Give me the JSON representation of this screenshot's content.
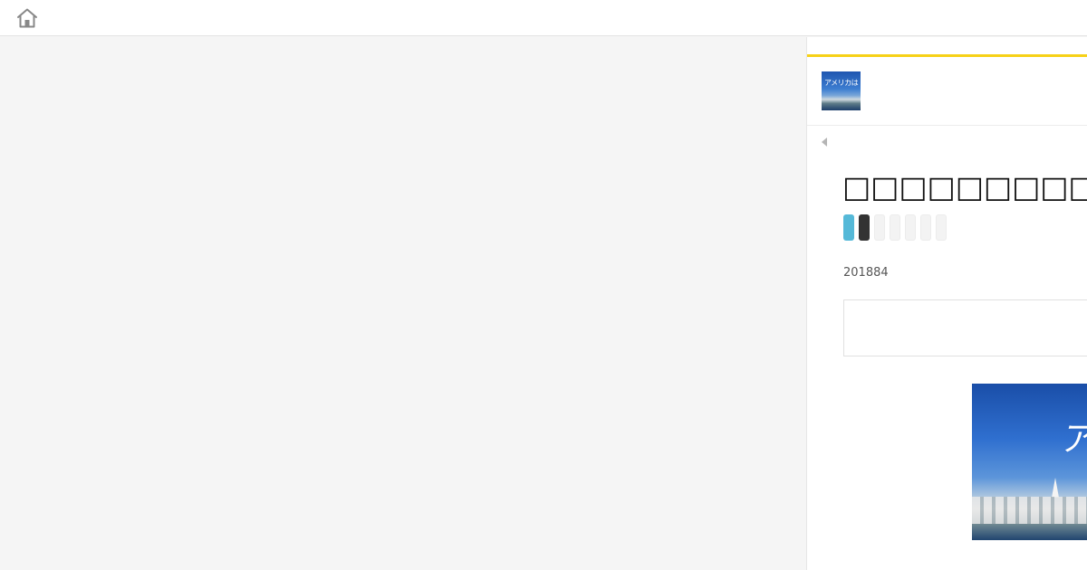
{
  "topbar": {
    "home_icon": "home-icon"
  },
  "panel": {
    "accent_color": "#f7d117",
    "blog_icon_text": "アメリカは いつも夢見て",
    "back_icon": "caret-left-icon",
    "post": {
      "title": "□□□□□□□□□□□□□□□□□",
      "date": "201884",
      "image_title_text": "アメ"
    },
    "share_buttons": [
      {
        "name": "share-twitter",
        "color": "#55b9d8"
      },
      {
        "name": "share-hatena",
        "color": "#333333"
      },
      {
        "name": "share-placeholder-1",
        "color": "#f3f3f3"
      },
      {
        "name": "share-placeholder-2",
        "color": "#f3f3f3"
      },
      {
        "name": "share-placeholder-3",
        "color": "#f3f3f3"
      },
      {
        "name": "share-placeholder-4",
        "color": "#f3f3f3"
      },
      {
        "name": "share-placeholder-5",
        "color": "#f3f3f3"
      }
    ]
  }
}
